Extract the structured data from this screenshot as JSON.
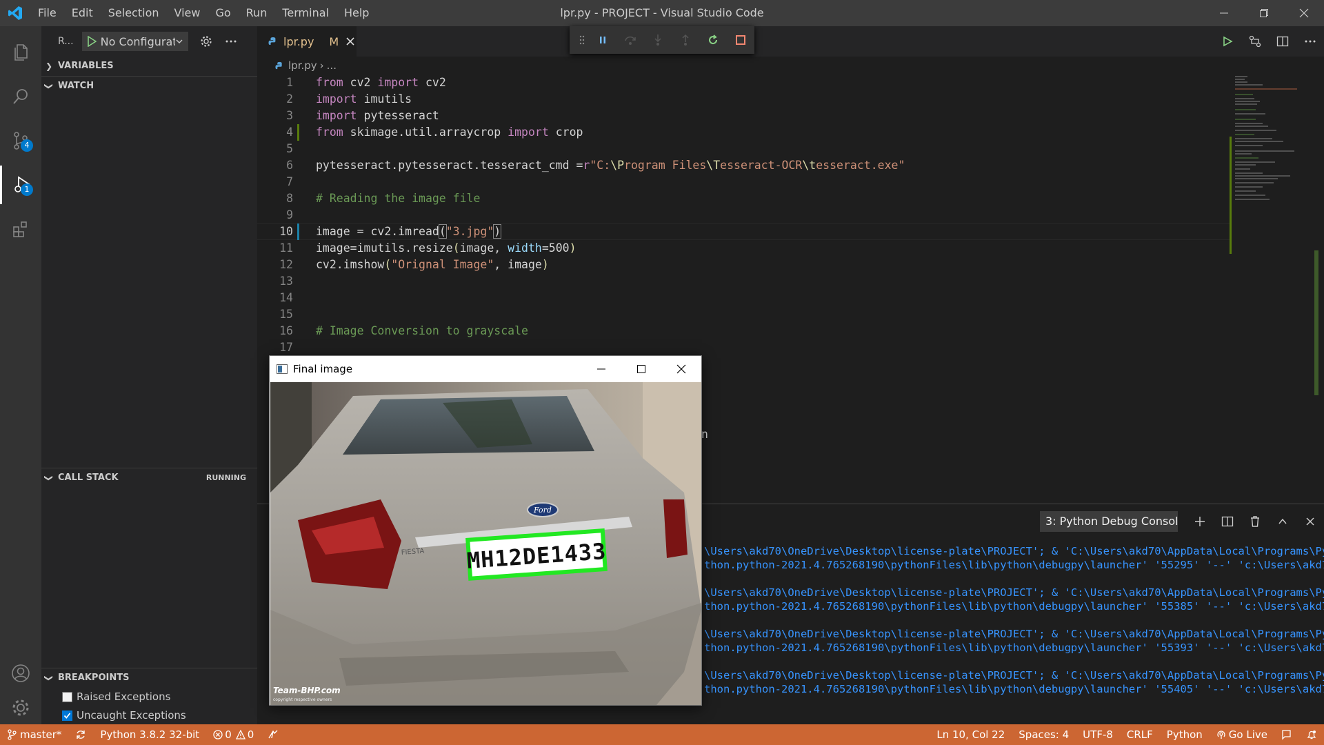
{
  "titlebar": {
    "menu": [
      "File",
      "Edit",
      "Selection",
      "View",
      "Go",
      "Run",
      "Terminal",
      "Help"
    ],
    "window_title": "lpr.py - PROJECT - Visual Studio Code"
  },
  "activity_bar": {
    "source_control_badge": "4",
    "run_debug_badge": "1"
  },
  "sidebar": {
    "header_label": "R...",
    "configuration": "No Configurati",
    "sections": {
      "variables": "VARIABLES",
      "watch": "WATCH",
      "call_stack": "CALL STACK",
      "call_stack_status": "RUNNING",
      "breakpoints": "BREAKPOINTS"
    },
    "breakpoint_items": [
      {
        "label": "Raised Exceptions",
        "checked": false
      },
      {
        "label": "Uncaught Exceptions",
        "checked": true
      }
    ]
  },
  "editor": {
    "tab": {
      "name": "lpr.py",
      "status": "M"
    },
    "breadcrumb": {
      "file": "lpr.py",
      "rest": "..."
    },
    "current_line": 10,
    "lines": [
      {
        "n": "1",
        "t": "from cv2 import cv2"
      },
      {
        "n": "2",
        "t": "import imutils"
      },
      {
        "n": "3",
        "t": "import pytesseract"
      },
      {
        "n": "4",
        "t": "from skimage.util.arraycrop import crop"
      },
      {
        "n": "5",
        "t": ""
      },
      {
        "n": "6",
        "t": "pytesseract.pytesseract.tesseract_cmd =r\"C:\\Program Files\\Tesseract-OCR\\tesseract.exe\""
      },
      {
        "n": "7",
        "t": ""
      },
      {
        "n": "8",
        "t": "# Reading the image file"
      },
      {
        "n": "9",
        "t": ""
      },
      {
        "n": "10",
        "t": "image = cv2.imread(\"3.jpg\")"
      },
      {
        "n": "11",
        "t": "image=imutils.resize(image, width=500)"
      },
      {
        "n": "12",
        "t": "cv2.imshow(\"Orignal Image\", image)"
      },
      {
        "n": "13",
        "t": ""
      },
      {
        "n": "14",
        "t": ""
      },
      {
        "n": "15",
        "t": ""
      },
      {
        "n": "16",
        "t": "# Image Conversion to grayscale"
      },
      {
        "n": "17",
        "t": ""
      }
    ],
    "partial_char": "n"
  },
  "panel": {
    "terminal_selector": "3: Python Debug Console",
    "terminal_lines": [
      {
        "a": "\\Users\\akd70\\OneDrive\\Desktop\\license-plate\\PROJECT'; & 'C:\\Users\\akd70\\AppData\\Local\\Programs\\Py",
        "b": "thon.python-2021.4.765268190\\pythonFiles\\lib\\python\\debugpy\\launcher' '55295' '--' 'c:\\Users\\akd7"
      },
      {
        "a": "\\Users\\akd70\\OneDrive\\Desktop\\license-plate\\PROJECT'; & 'C:\\Users\\akd70\\AppData\\Local\\Programs\\Py",
        "b": "thon.python-2021.4.765268190\\pythonFiles\\lib\\python\\debugpy\\launcher' '55385' '--' 'c:\\Users\\akd7"
      },
      {
        "a": "\\Users\\akd70\\OneDrive\\Desktop\\license-plate\\PROJECT'; & 'C:\\Users\\akd70\\AppData\\Local\\Programs\\Py",
        "b": "thon.python-2021.4.765268190\\pythonFiles\\lib\\python\\debugpy\\launcher' '55393' '--' 'c:\\Users\\akd7"
      },
      {
        "a": "\\Users\\akd70\\OneDrive\\Desktop\\license-plate\\PROJECT'; & 'C:\\Users\\akd70\\AppData\\Local\\Programs\\Py",
        "b": "thon.python-2021.4.765268190\\pythonFiles\\lib\\python\\debugpy\\launcher' '55405' '--' 'c:\\Users\\akd7"
      }
    ]
  },
  "image_window": {
    "title": "Final image",
    "plate_text": "MH12DE1433",
    "car_brand": "Ford",
    "model_text": "FIESTA",
    "watermark": "Team-BHP.com",
    "watermark_sub": "copyright respective owners"
  },
  "statusbar": {
    "branch": "master*",
    "interpreter": "Python 3.8.2 32-bit",
    "errors": "0",
    "warnings": "0",
    "cursor": "Ln 10, Col 22",
    "spaces": "Spaces: 4",
    "encoding": "UTF-8",
    "eol": "CRLF",
    "language": "Python",
    "golive": "Go Live"
  },
  "colors": {
    "statusbar": "#cc6633",
    "activity": "#333333",
    "sidebar": "#252526",
    "editor": "#1e1e1e",
    "plate_box": "#22e822"
  }
}
